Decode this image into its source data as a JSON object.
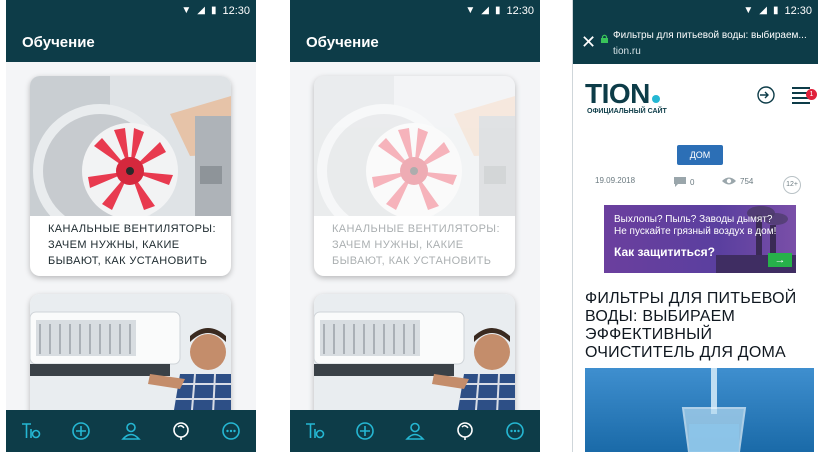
{
  "status_bar": {
    "time": "12:30"
  },
  "app": {
    "title": "Обучение",
    "cards": [
      {
        "title": "КАНАЛЬНЫЕ ВЕНТИЛЯТОРЫ: ЗАЧЕМ НУЖНЫ, КАКИЕ БЫВАЮТ, КАК УСТАНОВИТЬ"
      }
    ],
    "nav_icons": [
      "products-icon",
      "add-icon",
      "profile-icon",
      "tips-icon",
      "more-icon"
    ]
  },
  "browser": {
    "page_title": "Фильтры для питьевой воды: выбираем...",
    "url": "tion.ru",
    "logo_text": "TION",
    "logo_subtitle": "ОФИЦИАЛЬНЫЙ САЙТ",
    "menu_badge": "1",
    "category_tag": "ДОМ",
    "date": "19.09.2018",
    "comments": "0",
    "views": "754",
    "age_rating": "12+",
    "banner": {
      "line1": "Выхлопы? Пыль? Заводы дымят?",
      "line2": "Не пускайте грязный воздух в дом!",
      "cta": "Как защититься?",
      "button": "→"
    },
    "article_title": "ФИЛЬТРЫ ДЛЯ ПИТЬЕВОЙ ВОДЫ: ВЫБИРАЕМ ЭФФЕКТИВНЫЙ ОЧИСТИТЕЛЬ ДЛЯ ДОМА"
  },
  "colors": {
    "primary": "#0d3c48",
    "accent": "#25b7d3",
    "fan_red": "#e83a4f",
    "banner_purple": "#5a3f9f",
    "cta_green": "#27b14a"
  }
}
